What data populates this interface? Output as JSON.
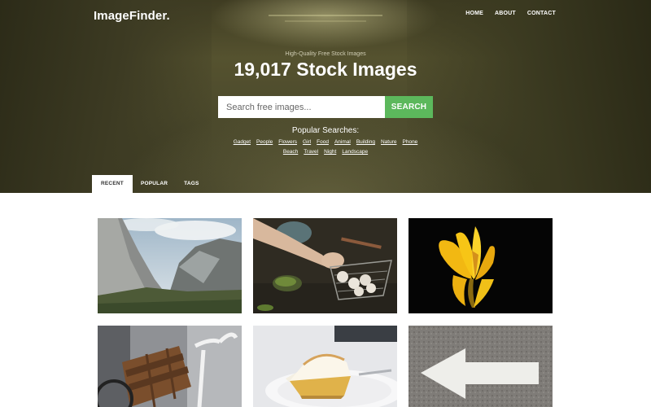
{
  "header": {
    "logo": "ImageFinder.",
    "nav": [
      "HOME",
      "ABOUT",
      "CONTACT"
    ]
  },
  "hero": {
    "subtitle": "High-Quality Free Stock Images",
    "title": "19,017 Stock Images"
  },
  "search": {
    "placeholder": "Search free images...",
    "button_label": "SEARCH",
    "button_color": "#5cb85c"
  },
  "popular": {
    "label": "Popular Searches:",
    "row1": [
      "Gadget",
      "People",
      "Flowers",
      "Girl",
      "Food",
      "Animal",
      "Building",
      "Nature",
      "Phone"
    ],
    "row2": [
      "Beach",
      "Travel",
      "Night",
      "Landscape"
    ]
  },
  "tabs": [
    {
      "label": "RECENT",
      "active": true
    },
    {
      "label": "POPULAR",
      "active": false
    },
    {
      "label": "TAGS",
      "active": false
    }
  ],
  "gallery": [
    {
      "subject": "mountain valley landscape"
    },
    {
      "subject": "hand with wire basket of food"
    },
    {
      "subject": "yellow tulip on black"
    },
    {
      "subject": "bicycle with wooden crate"
    },
    {
      "subject": "slice of pie on plate"
    },
    {
      "subject": "arrow painted on asphalt"
    }
  ]
}
